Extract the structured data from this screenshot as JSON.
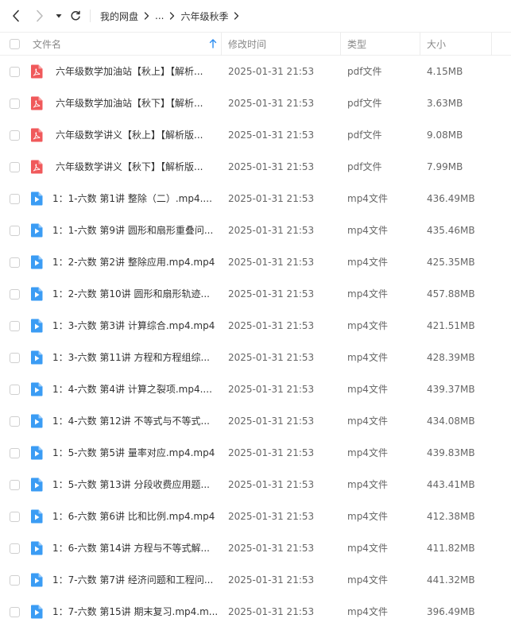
{
  "breadcrumb": [
    "我的网盘",
    "...",
    "六年级秋季"
  ],
  "columns": {
    "name": "文件名",
    "modified": "修改时间",
    "type": "类型",
    "size": "大小"
  },
  "files": [
    {
      "kind": "pdf",
      "name": "六年级数学加油站【秋上】【解析...",
      "modified": "2025-01-31 21:53",
      "type": "pdf文件",
      "size": "4.15MB"
    },
    {
      "kind": "pdf",
      "name": "六年级数学加油站【秋下】【解析...",
      "modified": "2025-01-31 21:53",
      "type": "pdf文件",
      "size": "3.63MB"
    },
    {
      "kind": "pdf",
      "name": "六年级数学讲义【秋上】【解析版...",
      "modified": "2025-01-31 21:53",
      "type": "pdf文件",
      "size": "9.08MB"
    },
    {
      "kind": "pdf",
      "name": "六年级数学讲义【秋下】【解析版...",
      "modified": "2025-01-31 21:53",
      "type": "pdf文件",
      "size": "7.99MB"
    },
    {
      "kind": "mp4",
      "name": "1：1-六数 第1讲 整除（二）.mp4....",
      "modified": "2025-01-31 21:53",
      "type": "mp4文件",
      "size": "436.49MB"
    },
    {
      "kind": "mp4",
      "name": "1：1-六数 第9讲 圆形和扇形重叠问...",
      "modified": "2025-01-31 21:53",
      "type": "mp4文件",
      "size": "435.46MB"
    },
    {
      "kind": "mp4",
      "name": "1：2-六数 第2讲 整除应用.mp4.mp4",
      "modified": "2025-01-31 21:53",
      "type": "mp4文件",
      "size": "425.35MB"
    },
    {
      "kind": "mp4",
      "name": "1：2-六数 第10讲 圆形和扇形轨迹...",
      "modified": "2025-01-31 21:53",
      "type": "mp4文件",
      "size": "457.88MB"
    },
    {
      "kind": "mp4",
      "name": "1：3-六数 第3讲 计算综合.mp4.mp4",
      "modified": "2025-01-31 21:53",
      "type": "mp4文件",
      "size": "421.51MB"
    },
    {
      "kind": "mp4",
      "name": "1：3-六数 第11讲 方程和方程组综...",
      "modified": "2025-01-31 21:53",
      "type": "mp4文件",
      "size": "428.39MB"
    },
    {
      "kind": "mp4",
      "name": "1：4-六数 第4讲 计算之裂项.mp4....",
      "modified": "2025-01-31 21:53",
      "type": "mp4文件",
      "size": "439.37MB"
    },
    {
      "kind": "mp4",
      "name": "1：4-六数 第12讲 不等式与不等式...",
      "modified": "2025-01-31 21:53",
      "type": "mp4文件",
      "size": "434.08MB"
    },
    {
      "kind": "mp4",
      "name": "1：5-六数 第5讲 量率对应.mp4.mp4",
      "modified": "2025-01-31 21:53",
      "type": "mp4文件",
      "size": "439.83MB"
    },
    {
      "kind": "mp4",
      "name": "1：5-六数 第13讲 分段收费应用题...",
      "modified": "2025-01-31 21:53",
      "type": "mp4文件",
      "size": "443.41MB"
    },
    {
      "kind": "mp4",
      "name": "1：6-六数 第6讲 比和比例.mp4.mp4",
      "modified": "2025-01-31 21:53",
      "type": "mp4文件",
      "size": "412.38MB"
    },
    {
      "kind": "mp4",
      "name": "1：6-六数 第14讲 方程与不等式解...",
      "modified": "2025-01-31 21:53",
      "type": "mp4文件",
      "size": "411.82MB"
    },
    {
      "kind": "mp4",
      "name": "1：7-六数 第7讲 经济问题和工程问...",
      "modified": "2025-01-31 21:53",
      "type": "mp4文件",
      "size": "441.32MB"
    },
    {
      "kind": "mp4",
      "name": "1：7-六数 第15讲 期末复习.mp4.m...",
      "modified": "2025-01-31 21:53",
      "type": "mp4文件",
      "size": "396.49MB"
    }
  ],
  "icons": {
    "back": "chevron-left-icon",
    "forward": "chevron-right-icon",
    "history": "caret-down-icon",
    "refresh": "refresh-icon",
    "sort": "sort-up-arrow-icon",
    "pdf": "pdf-file-icon",
    "video": "video-file-icon"
  },
  "colors": {
    "pdf": "#f0595b",
    "video": "#3b9cf4",
    "sort_arrow": "#2e8ef0"
  }
}
